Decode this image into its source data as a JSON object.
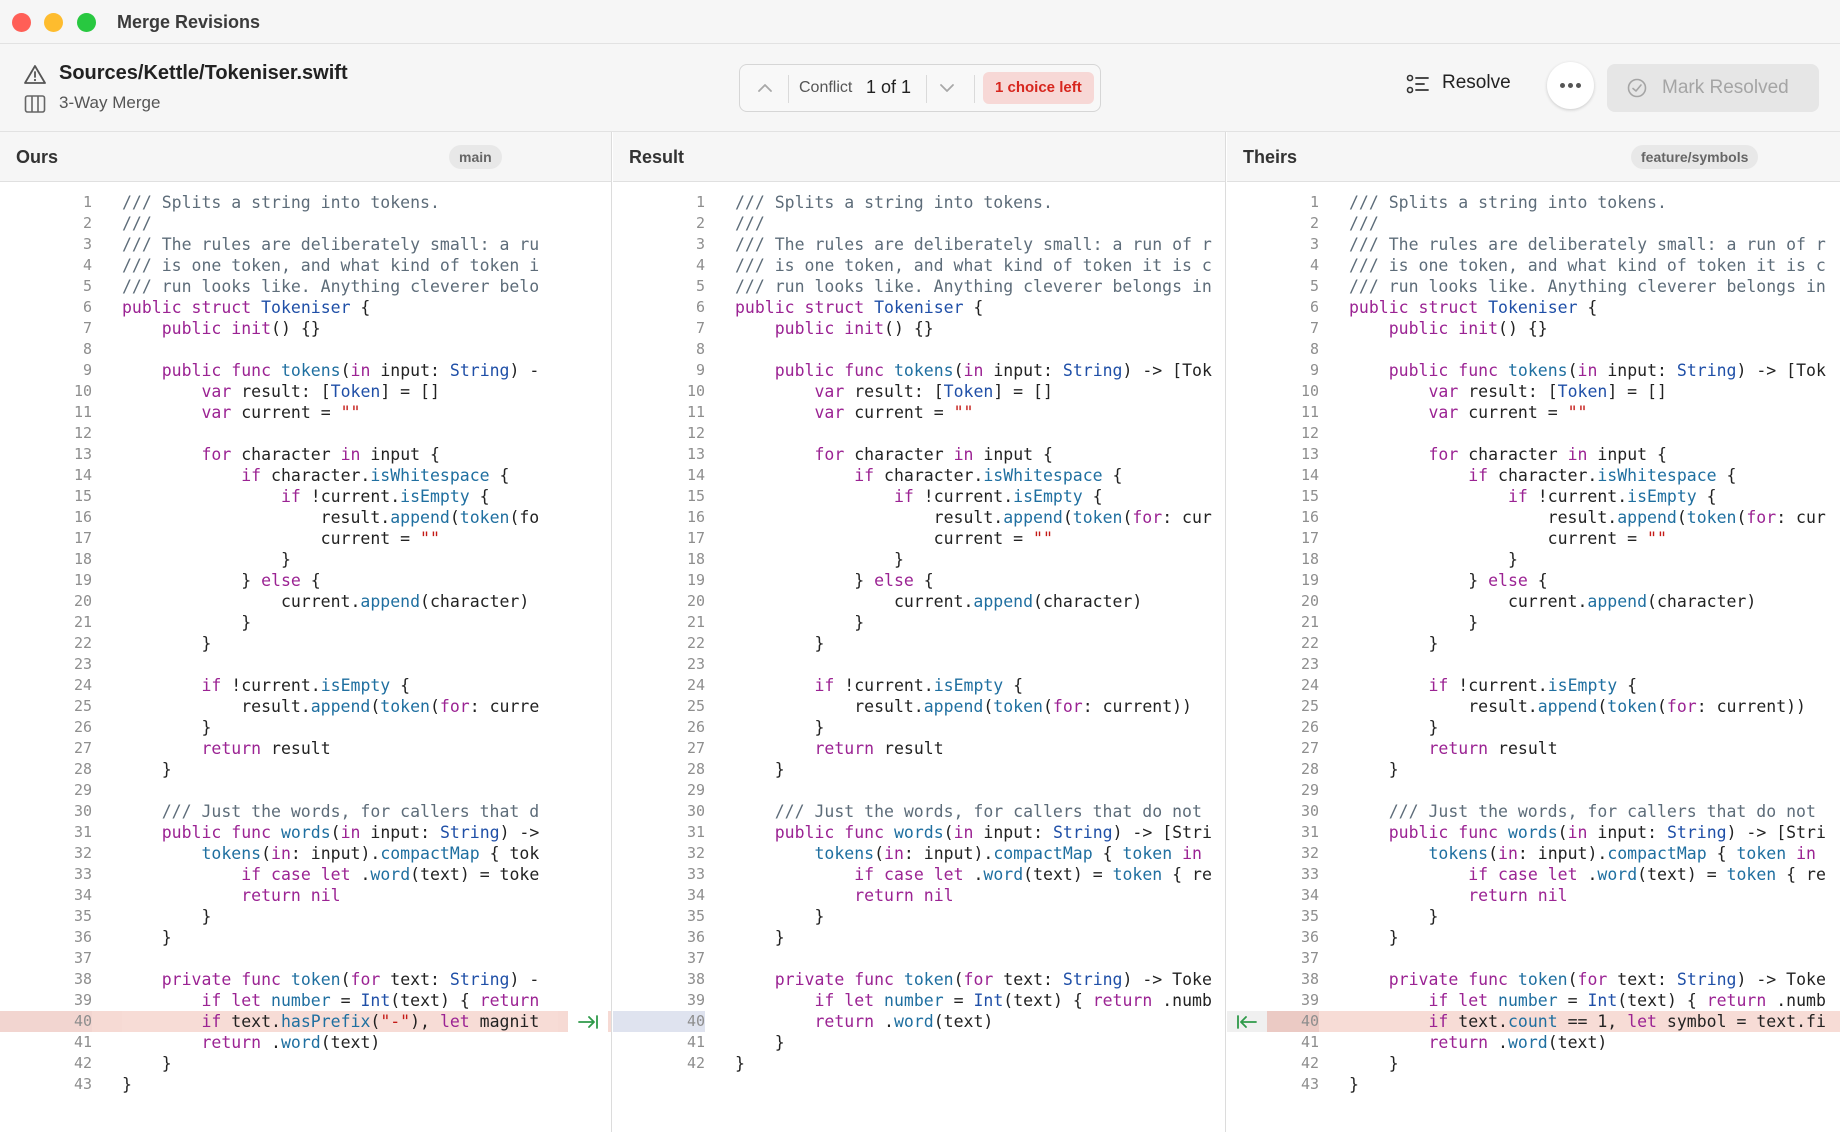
{
  "window": {
    "title": "Merge Revisions"
  },
  "file": {
    "path": "Sources/Kettle/Tokeniser.swift",
    "mode": "3-Way Merge"
  },
  "conflict": {
    "label": "Conflict",
    "count": "1 of 1",
    "choices_left": "1 choice left"
  },
  "actions": {
    "resolve": "Resolve",
    "mark_resolved": "Mark Resolved"
  },
  "icons": [
    "warning-icon",
    "columns-icon",
    "chevron-up-icon",
    "chevron-down-icon",
    "list-icon",
    "ellipsis-icon",
    "checkmark-circle-icon",
    "accept-arrow-icon"
  ],
  "colors": {
    "conflict_badge": "#d7261e",
    "conflict_line_bg": "#f7dcd6",
    "keyword": "#9b2393",
    "type": "#1f4fa7"
  },
  "panes": {
    "ours": {
      "title": "Ours",
      "branch": "main",
      "lines": [
        "/// Splits a string into tokens.",
        "///",
        "/// The rules are deliberately small: a ru",
        "/// is one token, and what kind of token i",
        "/// run looks like. Anything cleverer belo",
        "public struct Tokeniser {",
        "    public init() {}",
        "",
        "    public func tokens(in input: String) -",
        "        var result: [Token] = []",
        "        var current = \"\"",
        "",
        "        for character in input {",
        "            if character.isWhitespace {",
        "                if !current.isEmpty {",
        "                    result.append(token(fo",
        "                    current = \"\"",
        "                }",
        "            } else {",
        "                current.append(character)",
        "            }",
        "        }",
        "",
        "        if !current.isEmpty {",
        "            result.append(token(for: curre",
        "        }",
        "        return result",
        "    }",
        "",
        "    /// Just the words, for callers that d",
        "    public func words(in input: String) ->",
        "        tokens(in: input).compactMap { tok",
        "            if case let .word(text) = toke",
        "            return nil",
        "        }",
        "    }",
        "",
        "    private func token(for text: String) -",
        "        if let number = Int(text) { return",
        "        if text.hasPrefix(\"-\"), let magnit",
        "        return .word(text)",
        "    }",
        "}"
      ]
    },
    "result": {
      "title": "Result",
      "lines": [
        "/// Splits a string into tokens.",
        "///",
        "/// The rules are deliberately small: a run of r",
        "/// is one token, and what kind of token it is c",
        "/// run looks like. Anything cleverer belongs in",
        "public struct Tokeniser {",
        "    public init() {}",
        "",
        "    public func tokens(in input: String) -> [Tok",
        "        var result: [Token] = []",
        "        var current = \"\"",
        "",
        "        for character in input {",
        "            if character.isWhitespace {",
        "                if !current.isEmpty {",
        "                    result.append(token(for: cur",
        "                    current = \"\"",
        "                }",
        "            } else {",
        "                current.append(character)",
        "            }",
        "        }",
        "",
        "        if !current.isEmpty {",
        "            result.append(token(for: current))",
        "        }",
        "        return result",
        "    }",
        "",
        "    /// Just the words, for callers that do not",
        "    public func words(in input: String) -> [Stri",
        "        tokens(in: input).compactMap { token in",
        "            if case let .word(text) = token { re",
        "            return nil",
        "        }",
        "    }",
        "",
        "    private func token(for text: String) -> Toke",
        "        if let number = Int(text) { return .numb",
        "        return .word(text)",
        "    }",
        "}"
      ]
    },
    "theirs": {
      "title": "Theirs",
      "branch": "feature/symbols",
      "lines": [
        "/// Splits a string into tokens.",
        "///",
        "/// The rules are deliberately small: a run of r",
        "/// is one token, and what kind of token it is c",
        "/// run looks like. Anything cleverer belongs in",
        "public struct Tokeniser {",
        "    public init() {}",
        "",
        "    public func tokens(in input: String) -> [Tok",
        "        var result: [Token] = []",
        "        var current = \"\"",
        "",
        "        for character in input {",
        "            if character.isWhitespace {",
        "                if !current.isEmpty {",
        "                    result.append(token(for: cur",
        "                    current = \"\"",
        "                }",
        "            } else {",
        "                current.append(character)",
        "            }",
        "        }",
        "",
        "        if !current.isEmpty {",
        "            result.append(token(for: current))",
        "        }",
        "        return result",
        "    }",
        "",
        "    /// Just the words, for callers that do not",
        "    public func words(in input: String) -> [Stri",
        "        tokens(in: input).compactMap { token in",
        "            if case let .word(text) = token { re",
        "            return nil",
        "        }",
        "    }",
        "",
        "    private func token(for text: String) -> Toke",
        "        if let number = Int(text) { return .numb",
        "        if text.count == 1, let symbol = text.fi",
        "        return .word(text)",
        "    }",
        "}"
      ]
    }
  },
  "conflict_line": 40
}
